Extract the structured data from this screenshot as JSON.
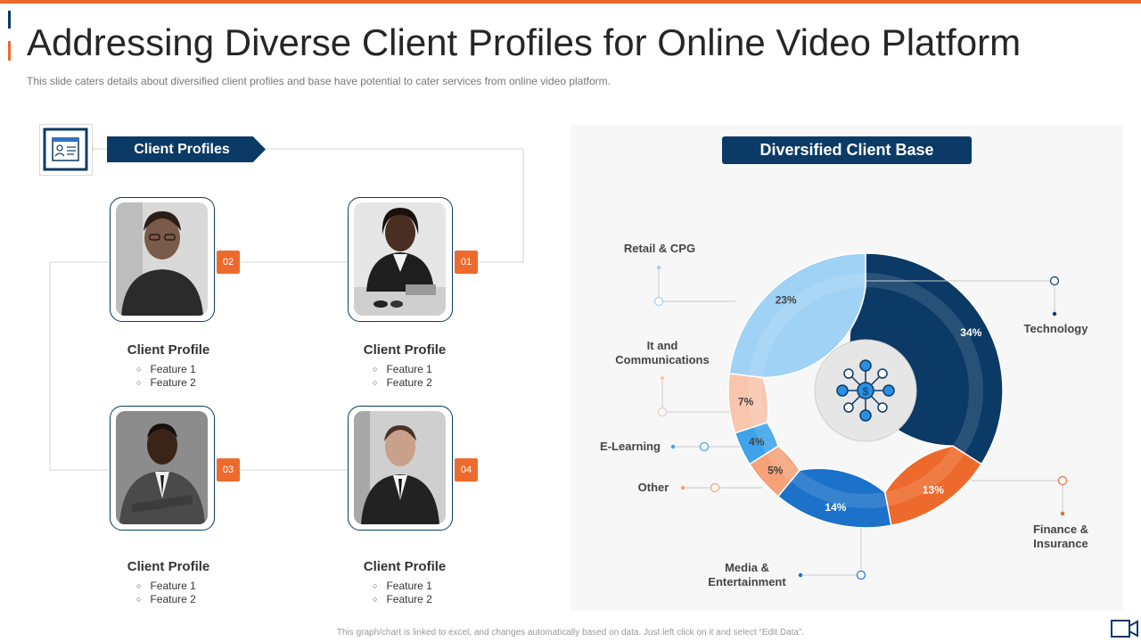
{
  "title": "Addressing Diverse Client Profiles for Online Video Platform",
  "subtitle": "This slide caters details about diversified  client profiles  and base have  potential to cater services from  online video  platform.",
  "footer": "This graph/chart is linked to excel, and changes automatically based on data. Just left click on it and select “Edit Data”.",
  "left_banner": "Client Profiles",
  "right_banner": "Diversified Client Base",
  "profiles": [
    {
      "badge": "02",
      "label": "Client Profile",
      "features": [
        "Feature 1",
        "Feature 2"
      ]
    },
    {
      "badge": "01",
      "label": "Client Profile",
      "features": [
        "Feature 1",
        "Feature 2"
      ]
    },
    {
      "badge": "03",
      "label": "Client Profile",
      "features": [
        "Feature 1",
        "Feature 2"
      ]
    },
    {
      "badge": "04",
      "label": "Client Profile",
      "features": [
        "Feature 1",
        "Feature 2"
      ]
    }
  ],
  "chart_data": {
    "type": "pie",
    "variant": "donut",
    "title": "Diversified Client Base",
    "categories": [
      "Technology",
      "Finance & Insurance",
      "Media & Entertainment",
      "Other",
      "E-Learning",
      "It and Communications",
      "Retail & CPG"
    ],
    "values": [
      34,
      13,
      14,
      5,
      4,
      7,
      23
    ],
    "labels": [
      "34%",
      "13%",
      "14%",
      "5%",
      "4%",
      "7%",
      "23%"
    ],
    "colors": [
      "#0b3a66",
      "#ee6a2c",
      "#1c72c9",
      "#f5a27a",
      "#3ea3ea",
      "#f9c5ad",
      "#9fd2f5"
    ],
    "center_icon": "network-dollar-icon"
  }
}
